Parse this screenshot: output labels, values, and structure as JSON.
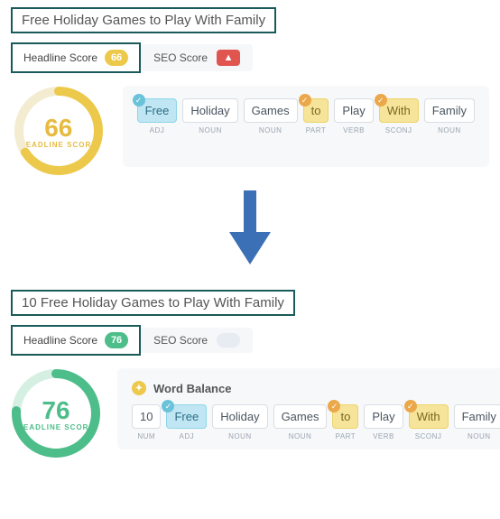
{
  "top": {
    "headline": "Free Holiday Games to Play With Family",
    "headline_tab_label": "Headline Score",
    "headline_score": "66",
    "seo_tab_label": "SEO Score",
    "seo_warning_glyph": "▲",
    "gauge_value": "66",
    "gauge_label": "HEADLINE SCORE",
    "tokens": [
      {
        "word": "Free",
        "pos": "ADJ",
        "hl": "blue",
        "badge": "blue"
      },
      {
        "word": "Holiday",
        "pos": "NOUN",
        "hl": "",
        "badge": ""
      },
      {
        "word": "Games",
        "pos": "NOUN",
        "hl": "",
        "badge": ""
      },
      {
        "word": "to",
        "pos": "PART",
        "hl": "yellow",
        "badge": "orange"
      },
      {
        "word": "Play",
        "pos": "VERB",
        "hl": "",
        "badge": ""
      },
      {
        "word": "With",
        "pos": "SCONJ",
        "hl": "yellow",
        "badge": "orange"
      },
      {
        "word": "Family",
        "pos": "NOUN",
        "hl": "",
        "badge": ""
      }
    ]
  },
  "bottom": {
    "headline": "10 Free Holiday Games to Play With Family",
    "headline_tab_label": "Headline Score",
    "headline_score": "76",
    "seo_tab_label": "SEO Score",
    "gauge_value": "76",
    "gauge_label": "HEADLINE SCORE",
    "word_balance_label": "Word Balance",
    "tokens": [
      {
        "word": "10",
        "pos": "NUM",
        "hl": "",
        "badge": ""
      },
      {
        "word": "Free",
        "pos": "ADJ",
        "hl": "blue",
        "badge": "blue"
      },
      {
        "word": "Holiday",
        "pos": "NOUN",
        "hl": "",
        "badge": ""
      },
      {
        "word": "Games",
        "pos": "NOUN",
        "hl": "",
        "badge": ""
      },
      {
        "word": "to",
        "pos": "PART",
        "hl": "yellow",
        "badge": "orange"
      },
      {
        "word": "Play",
        "pos": "VERB",
        "hl": "",
        "badge": ""
      },
      {
        "word": "With",
        "pos": "SCONJ",
        "hl": "yellow",
        "badge": "orange"
      },
      {
        "word": "Family",
        "pos": "NOUN",
        "hl": "",
        "badge": ""
      }
    ]
  },
  "colors": {
    "yellow": "#ecc94b",
    "green": "#4dbd8a",
    "teal_border": "#1a5a5a",
    "arrow": "#3b6fb6"
  }
}
